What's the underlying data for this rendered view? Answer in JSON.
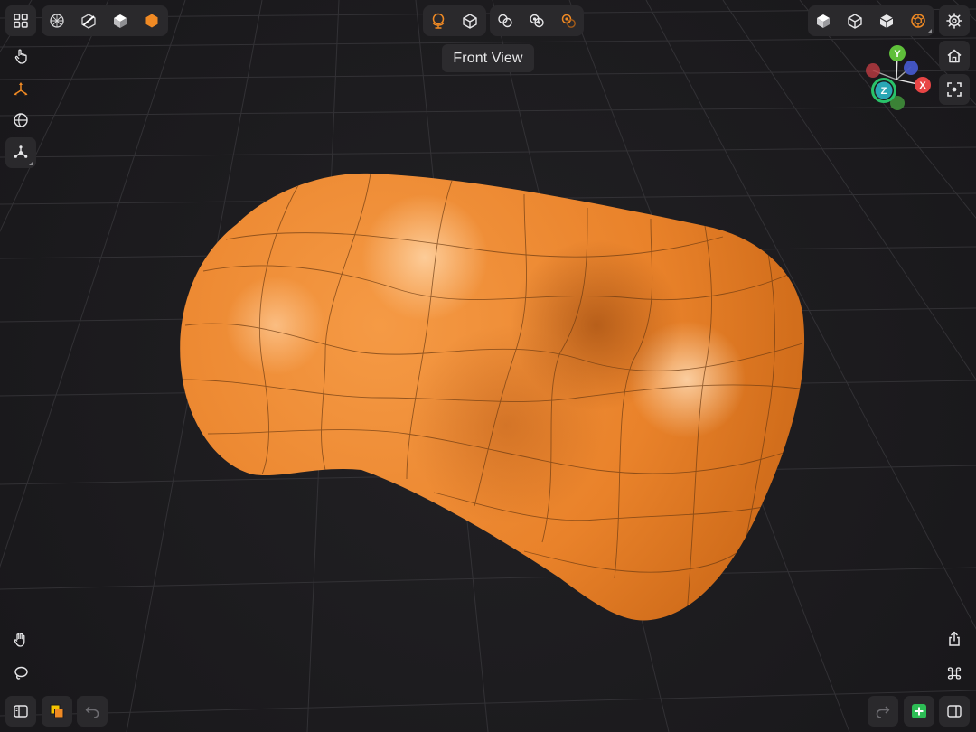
{
  "app": {
    "tooltip": "Front View",
    "accent_color": "#f08a24",
    "add_color": "#2dbd55"
  },
  "toolbar_left": [
    {
      "name": "grid-menu-icon"
    },
    {
      "name": "wireframe-sphere-icon"
    },
    {
      "name": "cube-knife-icon"
    },
    {
      "name": "solid-cube-icon"
    },
    {
      "name": "orange-hexagon-icon",
      "active": true
    }
  ],
  "toolbar_center": [
    {
      "name": "globe-stand-icon",
      "active": true
    },
    {
      "name": "cube-outline-icon"
    }
  ],
  "toolbar_center2": [
    {
      "name": "boolean-union-icon"
    },
    {
      "name": "boolean-intersect-icon"
    },
    {
      "name": "boolean-difference-icon",
      "active": true
    }
  ],
  "toolbar_right": [
    {
      "name": "shaded-cube-icon"
    },
    {
      "name": "wire-cube-icon"
    },
    {
      "name": "xray-cube-icon"
    },
    {
      "name": "render-sphere-icon",
      "active": true
    }
  ],
  "gizmo": {
    "x_label": "X",
    "y_label": "Y",
    "z_label": "Z",
    "x_color": "#e84545",
    "y_color": "#5fbf3a",
    "z_color": "#2aa7b5"
  }
}
